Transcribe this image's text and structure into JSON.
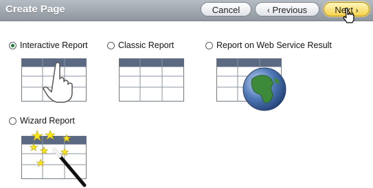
{
  "header": {
    "title": "Create Page",
    "cancel_label": "Cancel",
    "previous_label": "Previous",
    "next_label": "Next"
  },
  "options": [
    {
      "label": "Interactive Report",
      "selected": true,
      "icon": "table-hand-icon"
    },
    {
      "label": "Classic Report",
      "selected": false,
      "icon": "table-icon"
    },
    {
      "label": "Report on Web Service Result",
      "selected": false,
      "icon": "table-globe-icon"
    },
    {
      "label": "Wizard Report",
      "selected": false,
      "icon": "table-wand-icon"
    }
  ],
  "colors": {
    "header_bg": "#9aa1a8",
    "next_button_bg": "#f6d34a",
    "table_header": "#5b6a82",
    "radio_selected": "#1a7a38"
  }
}
